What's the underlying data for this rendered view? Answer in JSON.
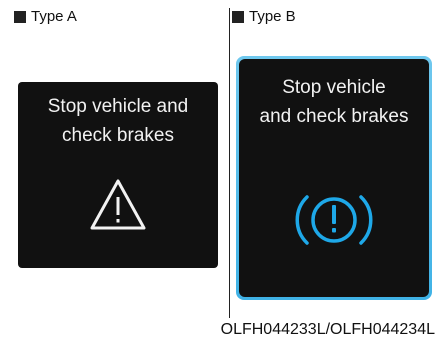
{
  "type_a": {
    "label": "Type A",
    "message_line1": "Stop vehicle and",
    "message_line2": "check brakes",
    "icon": "warning-triangle-icon"
  },
  "type_b": {
    "label": "Type B",
    "message_line1": "Stop vehicle",
    "message_line2": "and check brakes",
    "icon": "brake-warning-icon"
  },
  "caption": "OLFH044233L/OLFH044234L",
  "colors": {
    "panel": "#111111",
    "text": "#f2f2f2",
    "brake_icon": "#1ea8e8",
    "panel_b_border": "#4db9e8"
  }
}
